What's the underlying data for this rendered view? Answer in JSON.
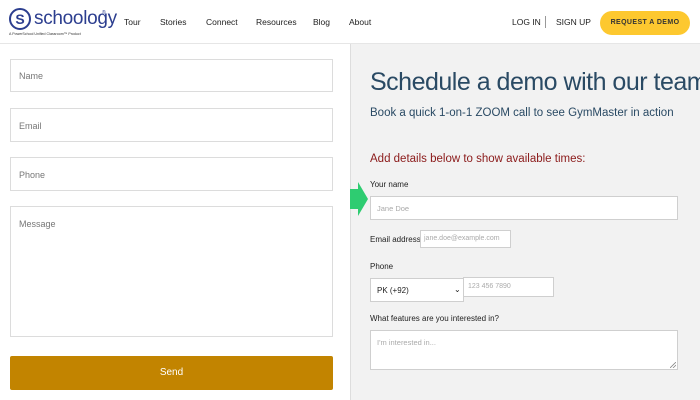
{
  "header": {
    "logo_letter": "S",
    "logo_word": "schoology",
    "logo_tm": "®",
    "logo_tagline": "A PowerSchool Unified Classroom™ Product",
    "nav": [
      "Tour",
      "Stories",
      "Connect",
      "Resources",
      "Blog",
      "About"
    ],
    "login": "LOG IN",
    "signup": "SIGN UP",
    "request_demo": "REQUEST A DEMO",
    "colors": {
      "brand": "#2c3e8f",
      "cta": "#fdc82f"
    }
  },
  "left_form": {
    "name_placeholder": "Name",
    "email_placeholder": "Email",
    "phone_placeholder": "Phone",
    "message_placeholder": "Message",
    "send_label": "Send",
    "send_color": "#c28400"
  },
  "demo_form": {
    "title": "Schedule a demo with our team",
    "subtitle": "Book a quick 1-on-1 ZOOM call to see GymMaster in action",
    "instruction": "Add details below to show available times:",
    "name_label": "Your name",
    "name_placeholder": "Jane Doe",
    "email_label": "Email address",
    "email_placeholder": "jane.doe@example.com",
    "phone_label": "Phone",
    "country_code": "PK (+92)",
    "phone_placeholder": "123 456 7890",
    "features_label": "What features are you interested in?",
    "features_placeholder": "I'm interested in...",
    "arrow_color": "#2ecc71",
    "title_color": "#2a4a64",
    "instruction_color": "#8b1a1a"
  }
}
